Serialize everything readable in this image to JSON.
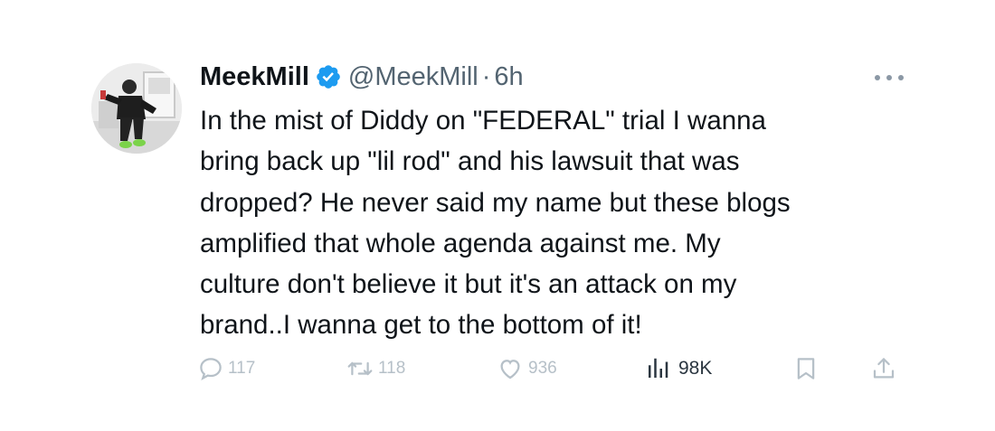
{
  "tweet": {
    "author": {
      "display_name": "MeekMill",
      "handle": "@MeekMill",
      "separator": "·",
      "time": "6h",
      "avatar_icon": "user-avatar",
      "verified_icon": "verified-badge-icon",
      "verified_color": "#1d9bf0"
    },
    "more_icon": "more-horizontal-icon",
    "text_lines": [
      "In the mist of Diddy on  \"FEDERAL\" trial I wanna",
      "bring back up \"lil rod\" and his lawsuit that was",
      "dropped?  He never said my name but these blogs",
      "amplified that whole agenda against me. My",
      "culture don't believe it but it's an attack on my",
      "brand..I wanna get to the bottom of it!"
    ],
    "actions": {
      "replies": "117",
      "reposts": "118",
      "likes": "936",
      "views": "98K"
    }
  }
}
